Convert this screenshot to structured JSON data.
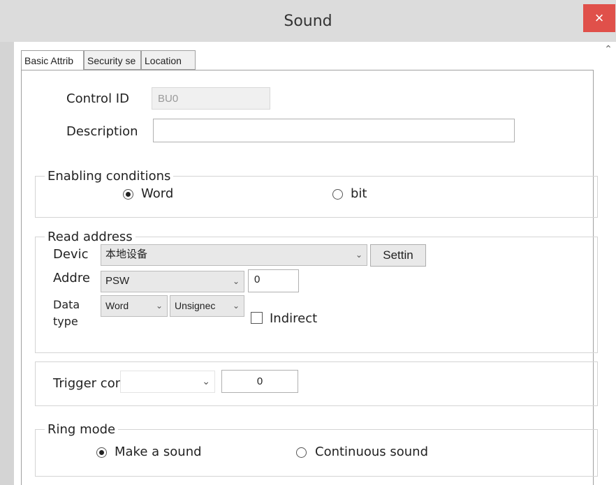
{
  "window": {
    "title": "Sound",
    "close_glyph": "×"
  },
  "tabs": [
    {
      "label": "Basic Attrib"
    },
    {
      "label": "Security se"
    },
    {
      "label": "Location"
    }
  ],
  "basic": {
    "control_id_label": "Control ID",
    "control_id_value": "BU0",
    "description_label": "Description",
    "description_value": ""
  },
  "enabling": {
    "legend": "Enabling conditions",
    "options": [
      "Word",
      "bit"
    ],
    "selected": "Word"
  },
  "read_address": {
    "legend": "Read address",
    "device_label": "Devic",
    "device_value": "本地设备",
    "settings_label": "Settin",
    "address_label": "Addre",
    "address_type": "PSW",
    "address_value": "0",
    "datatype_label_1": "Data",
    "datatype_label_2": "type",
    "datatype_word": "Word",
    "datatype_sign": "Unsignec",
    "indirect_label": "Indirect",
    "indirect_checked": false
  },
  "trigger": {
    "label": "Trigger conditions",
    "value": "0"
  },
  "ring_mode": {
    "legend": "Ring mode",
    "options": [
      "Make a sound",
      "Continuous sound"
    ],
    "selected": "Make a sound"
  }
}
